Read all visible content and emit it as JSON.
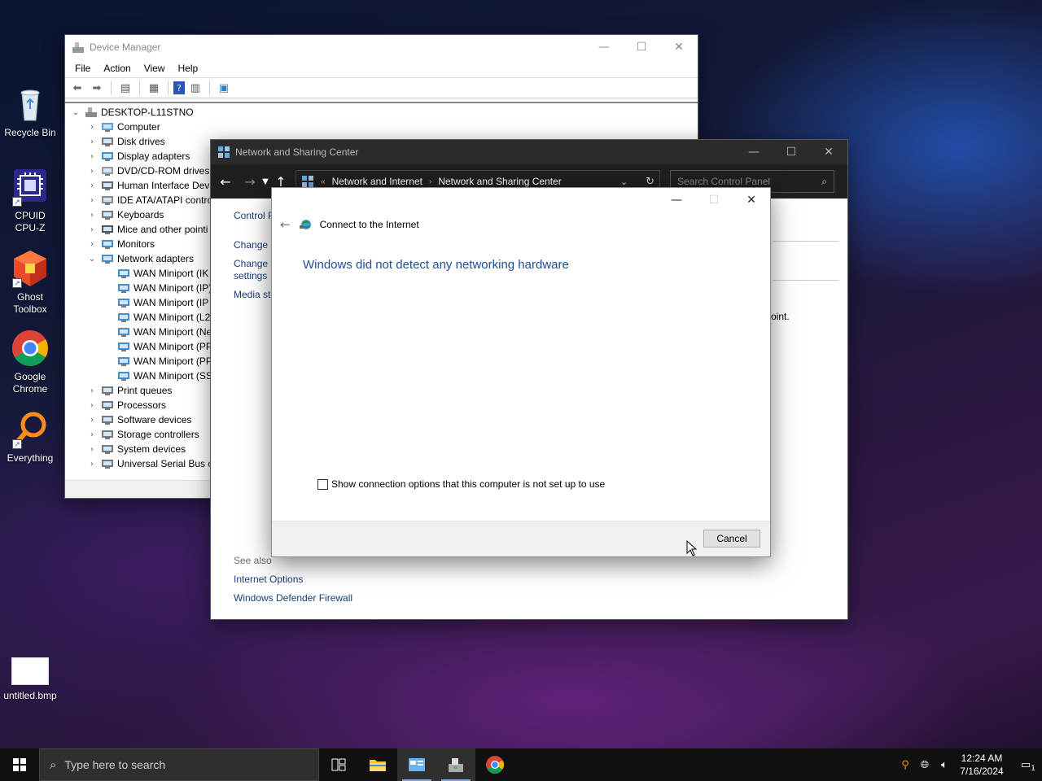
{
  "desktop": {
    "icons": [
      {
        "label": "Recycle Bin",
        "icon": "recycle-bin-icon"
      },
      {
        "label": "CPUID CPU-Z",
        "icon": "cpuz-icon"
      },
      {
        "label": "Ghost Toolbox",
        "icon": "ghost-toolbox-icon"
      },
      {
        "label": "Google Chrome",
        "icon": "chrome-icon"
      },
      {
        "label": "Everything",
        "icon": "everything-icon"
      },
      {
        "label": "untitled.bmp",
        "icon": "bitmap-file-icon"
      }
    ]
  },
  "device_manager": {
    "title": "Device Manager",
    "menu": [
      "File",
      "Action",
      "View",
      "Help"
    ],
    "root": "DESKTOP-L11STNO",
    "categories": [
      {
        "label": "Computer",
        "expanded": false
      },
      {
        "label": "Disk drives",
        "expanded": false
      },
      {
        "label": "Display adapters",
        "expanded": false
      },
      {
        "label": "DVD/CD-ROM drives",
        "expanded": false
      },
      {
        "label": "Human Interface Devi",
        "expanded": false
      },
      {
        "label": "IDE ATA/ATAPI contro",
        "expanded": false
      },
      {
        "label": "Keyboards",
        "expanded": false
      },
      {
        "label": "Mice and other pointi",
        "expanded": false
      },
      {
        "label": "Monitors",
        "expanded": false
      },
      {
        "label": "Network adapters",
        "expanded": true
      }
    ],
    "network_children": [
      "WAN Miniport (IK",
      "WAN Miniport (IP)",
      "WAN Miniport (IP",
      "WAN Miniport (L2",
      "WAN Miniport (Ne",
      "WAN Miniport (PP",
      "WAN Miniport (PP",
      "WAN Miniport (SS"
    ],
    "categories_after": [
      "Print queues",
      "Processors",
      "Software devices",
      "Storage controllers",
      "System devices",
      "Universal Serial Bus co"
    ]
  },
  "network_center": {
    "title": "Network and Sharing Center",
    "breadcrumb": [
      "Network and Internet",
      "Network and Sharing Center"
    ],
    "search_placeholder": "Search Control Panel",
    "left_links": [
      "Control P",
      "Change a",
      "Change a",
      "settings",
      "Media st"
    ],
    "partial_text": "oint.",
    "see_also_label": "See also",
    "see_also_links": [
      "Internet Options",
      "Windows Defender Firewall"
    ]
  },
  "dialog": {
    "header": "Connect to the Internet",
    "message": "Windows did not detect any networking hardware",
    "checkbox_label": "Show connection options that this computer is not set up to use",
    "checkbox_checked": false,
    "cancel_label": "Cancel"
  },
  "taskbar": {
    "search_placeholder": "Type here to search",
    "time": "12:24 AM",
    "date": "7/16/2024",
    "notification_count": "1"
  }
}
